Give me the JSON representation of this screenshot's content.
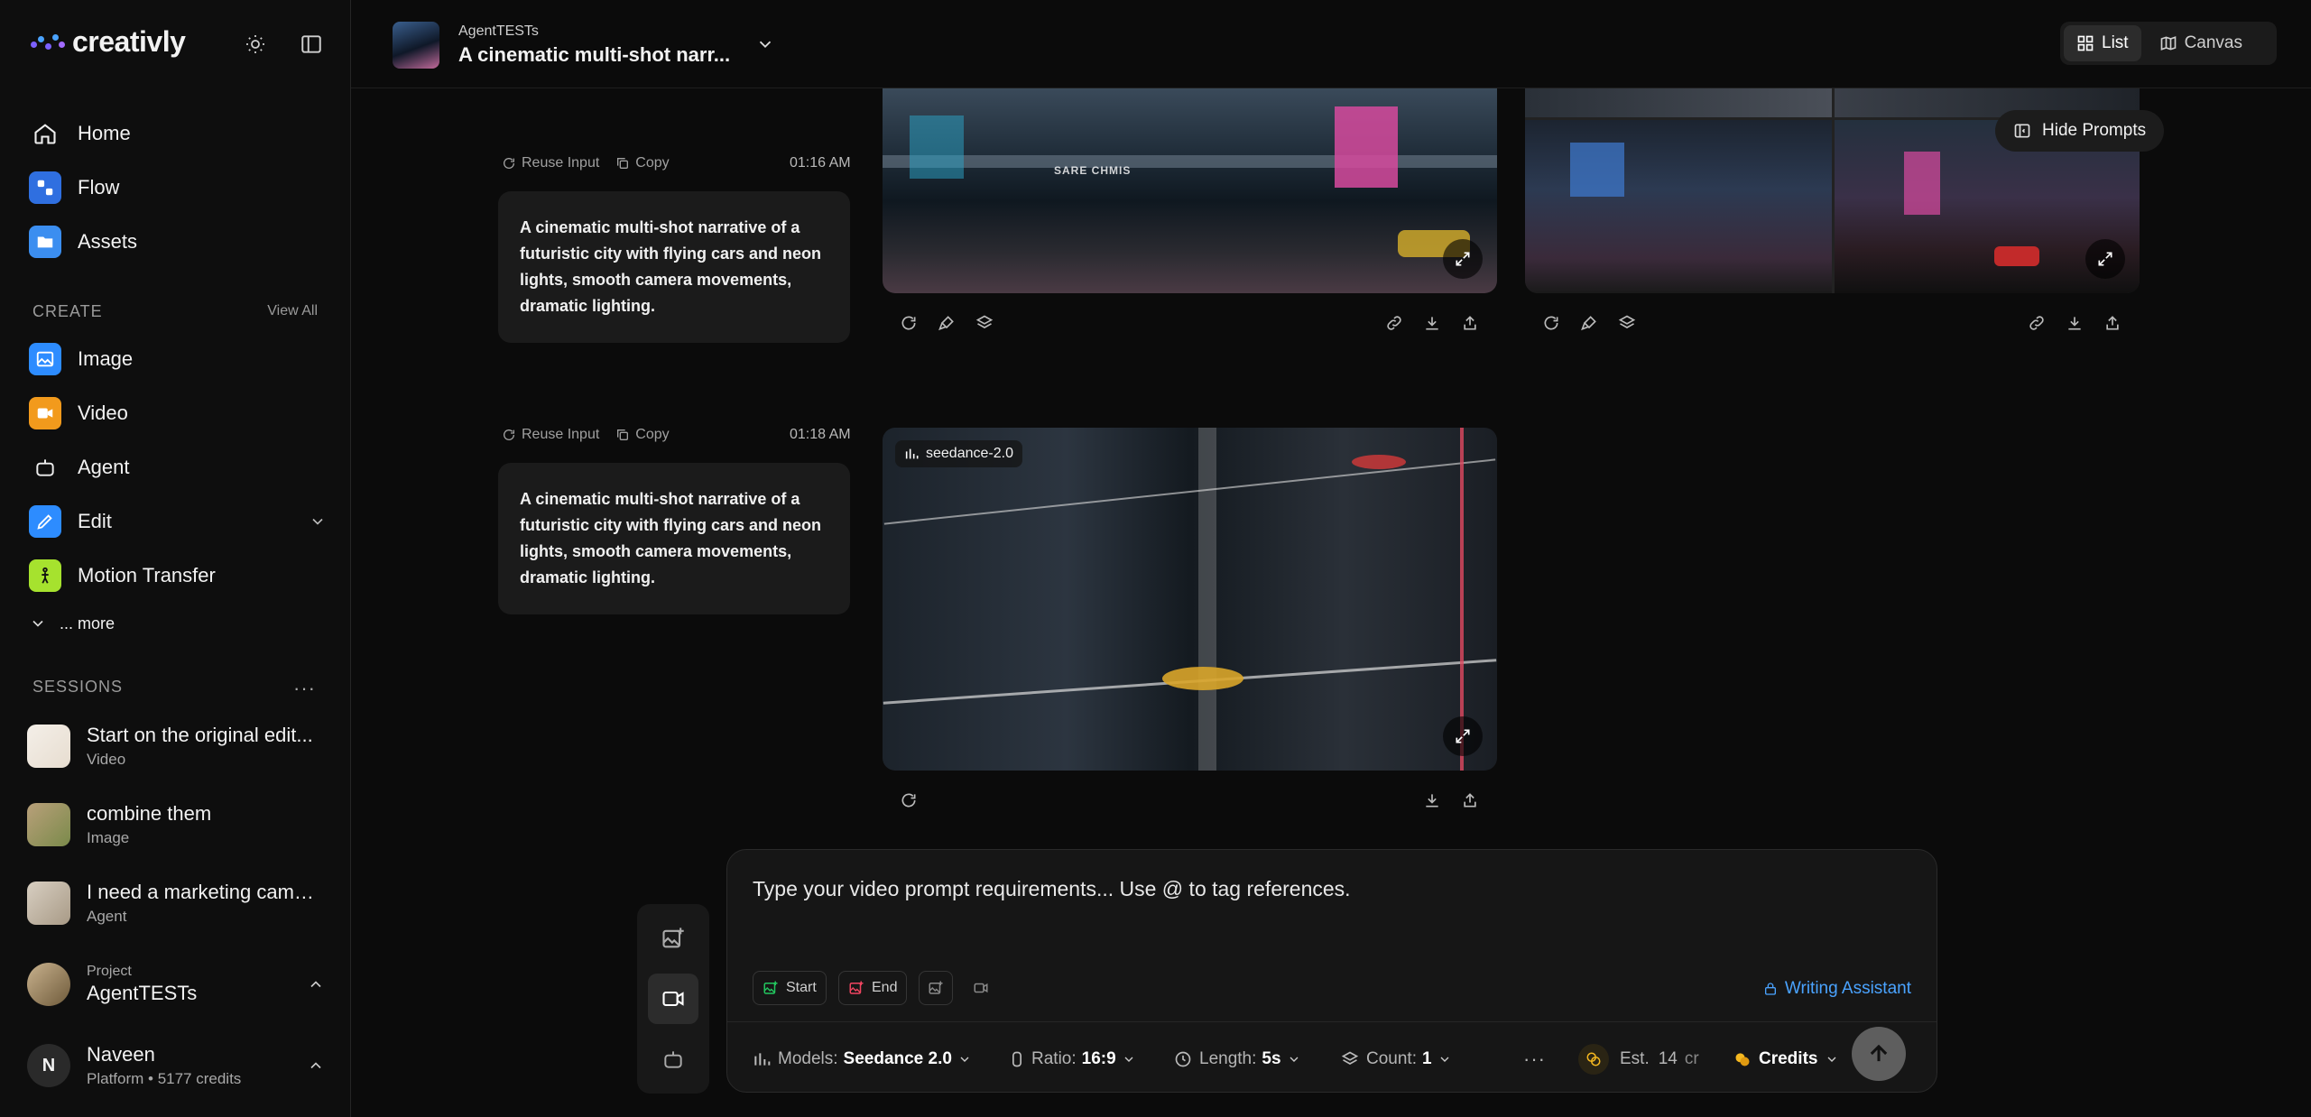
{
  "app": {
    "name": "creativly"
  },
  "nav": {
    "home": "Home",
    "flow": "Flow",
    "assets": "Assets",
    "create_label": "CREATE",
    "view_all": "View All",
    "image": "Image",
    "video": "Video",
    "agent": "Agent",
    "edit": "Edit",
    "motion_transfer": "Motion Transfer",
    "more": "... more"
  },
  "sessions": {
    "label": "SESSIONS",
    "items": [
      {
        "title": "Start on the original edit...",
        "type": "Video"
      },
      {
        "title": "combine them",
        "type": "Image"
      },
      {
        "title": "I need a marketing camp...",
        "type": "Agent"
      }
    ]
  },
  "project": {
    "label": "Project",
    "name": "AgentTESTs"
  },
  "user": {
    "initial": "N",
    "name": "Naveen",
    "sub": "Platform • 5177 credits"
  },
  "header": {
    "project_small": "AgentTESTs",
    "title": "A cinematic multi-shot narr...",
    "view_list": "List",
    "view_canvas": "Canvas"
  },
  "feed": {
    "reuse_input": "Reuse Input",
    "copy": "Copy",
    "hide_prompts": "Hide Prompts",
    "items": [
      {
        "time": "01:16 AM",
        "prompt": "A cinematic multi-shot narrative of a futuristic city with flying cars and neon lights, smooth camera movements, dramatic lighting.",
        "sign_text": "SARE CHMIS"
      },
      {
        "time": "01:18 AM",
        "prompt": "A cinematic multi-shot narrative of a futuristic city with flying cars and neon lights, smooth camera movements, dramatic lighting.",
        "model_badge": "seedance-2.0"
      }
    ]
  },
  "composer": {
    "placeholder": "Type your video prompt requirements... Use @ to tag references.",
    "chip_start": "Start",
    "chip_end": "End",
    "writing_assistant": "Writing Assistant",
    "models_label": "Models:",
    "models_value": "Seedance 2.0",
    "ratio_label": "Ratio:",
    "ratio_value": "16:9",
    "length_label": "Length:",
    "length_value": "5s",
    "count_label": "Count:",
    "count_value": "1",
    "est_label": "Est.",
    "est_value": "14",
    "est_unit": "cr",
    "credits": "Credits"
  },
  "colors": {
    "accent": "#4aa3ff",
    "bg": "#0b0b0b",
    "card": "#1b1b1b"
  }
}
